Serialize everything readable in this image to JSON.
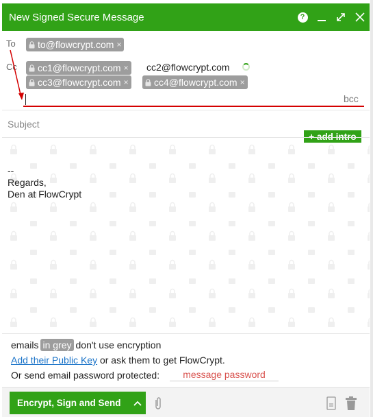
{
  "window": {
    "title": "New Signed Secure Message",
    "help_glyph": "?",
    "minimize_glyph": "—",
    "maximize_glyph": "⤢",
    "close_glyph": "✕"
  },
  "recipients": {
    "to_label": "To",
    "cc_label": "Cc",
    "to": [
      {
        "email": "to@flowcrypt.com",
        "encrypted": true
      }
    ],
    "cc": [
      {
        "email": "cc1@flowcrypt.com",
        "encrypted": true
      },
      {
        "email": "cc2@flowcrypt.com",
        "encrypted": false,
        "loading": true
      },
      {
        "email": "cc3@flowcrypt.com",
        "encrypted": true
      },
      {
        "email": "cc4@flowcrypt.com",
        "encrypted": true
      }
    ],
    "remove_glyph": "×",
    "bcc_label": "bcc"
  },
  "subject": {
    "placeholder": "Subject"
  },
  "add_intro_label": "+ add intro",
  "body": {
    "signature": "--\nRegards,\nDen at FlowCrypt"
  },
  "footer": {
    "line1_pre": "emails",
    "line1_badge": "in grey",
    "line1_post": "don't use encryption",
    "line2_link": "Add their Public Key",
    "line2_post": "or ask them to get FlowCrypt.",
    "line3": "Or send email password protected:",
    "password_placeholder": "message password"
  },
  "actions": {
    "send_label": "Encrypt, Sign and Send",
    "send_chevron": "^"
  },
  "colors": {
    "brand_green": "#31a217",
    "pill_grey": "#9d9d9d",
    "error_red": "#d40000",
    "link_blue": "#1a73c8"
  }
}
